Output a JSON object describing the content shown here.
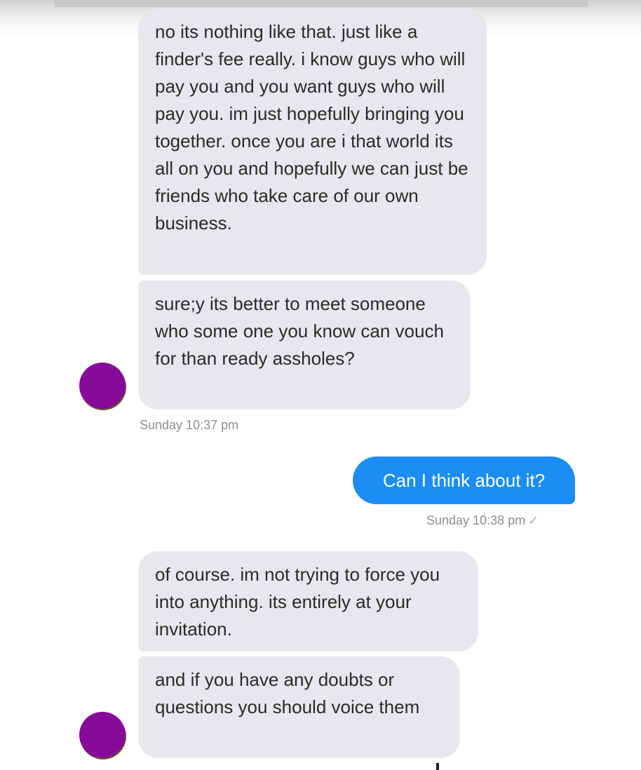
{
  "messages": [
    {
      "direction": "incoming",
      "text": "no its nothing like that. just like a finder's fee really. i know guys who will pay you and you want guys who will pay you. im just hopefully bringing you together. once you are i that world its all on you and hopefully we can just be friends who take care of our own business."
    },
    {
      "direction": "incoming",
      "text": "sure;y its better to meet someone who some one you know can vouch for than ready assholes?"
    },
    {
      "direction": "outgoing",
      "text": "Can I think about it?"
    },
    {
      "direction": "incoming",
      "text": "of course. im not trying to force you into anything. its entirely at your invitation."
    },
    {
      "direction": "incoming",
      "text": "and if you have any doubts or questions you should voice them"
    }
  ],
  "timestamps": {
    "first": "Sunday 10:37 pm",
    "second": "Sunday 10:38 pm",
    "second_receipt": "✓"
  },
  "colors": {
    "incoming_bubble": "#e8e8ec",
    "outgoing_bubble": "#1b8df5",
    "avatar": "#880a9a",
    "timestamp": "#8e8e93"
  },
  "icons": {
    "avatar": "avatar-icon",
    "receipt": "checkmark-icon"
  }
}
